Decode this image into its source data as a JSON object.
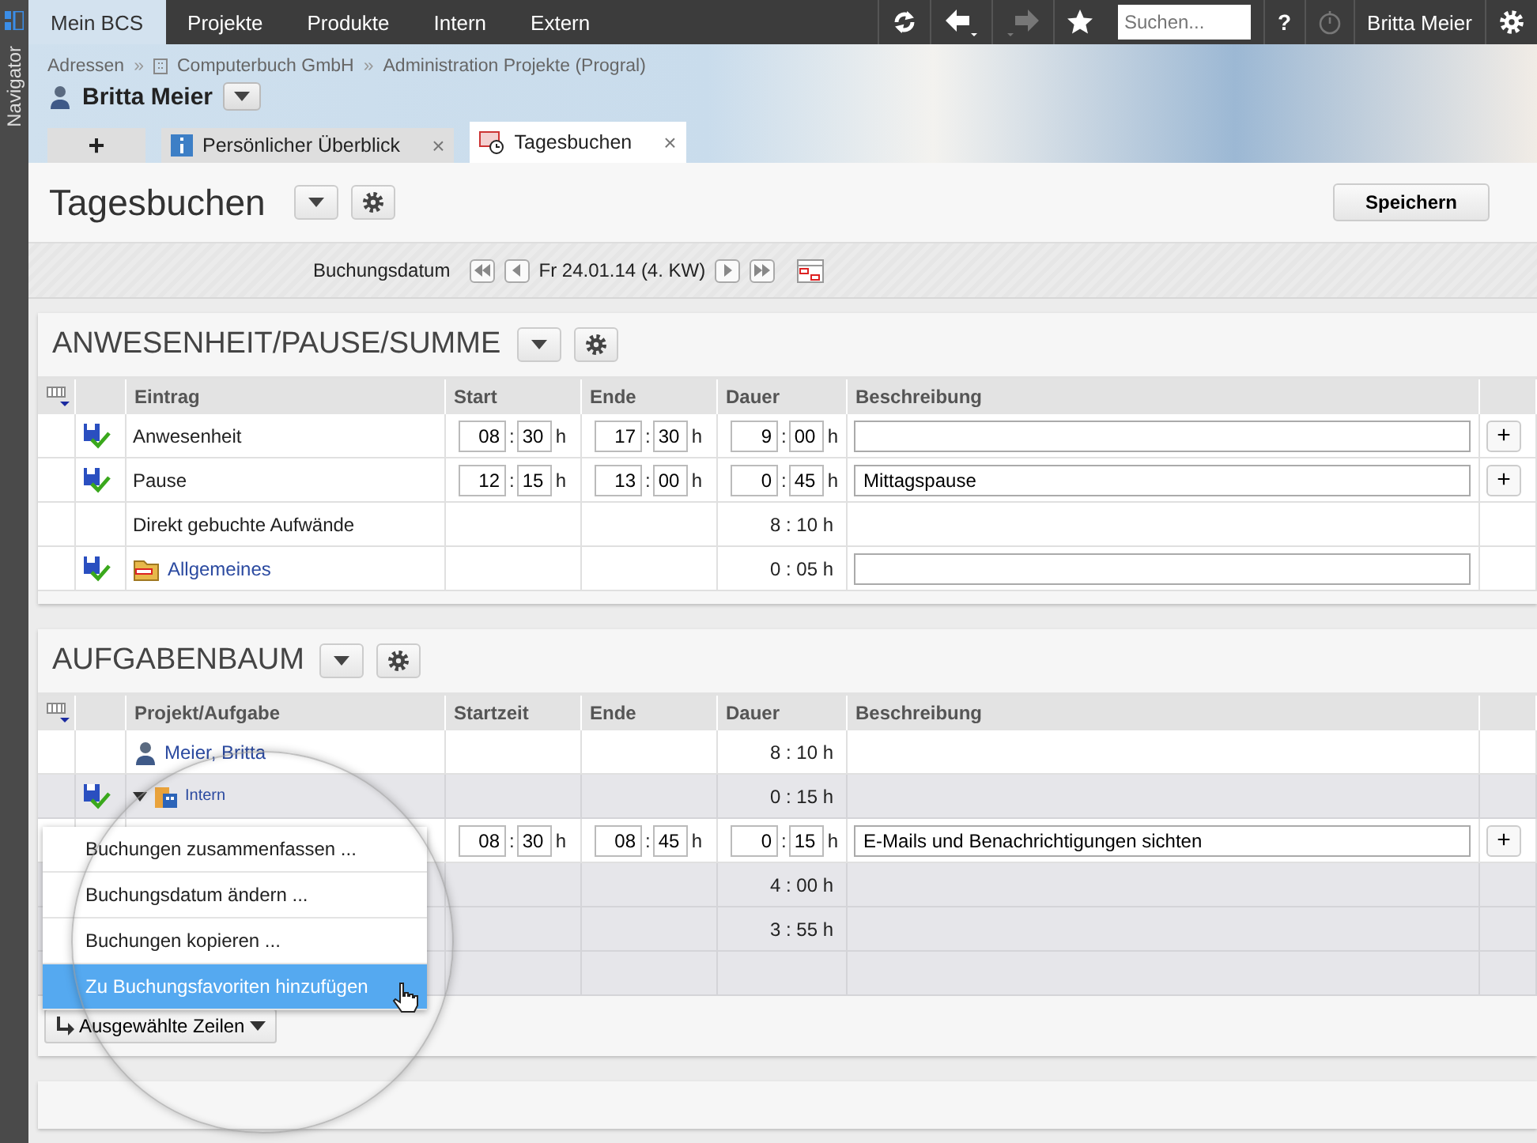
{
  "navigator": {
    "label": "Navigator"
  },
  "top_menu": [
    {
      "label": "Mein BCS",
      "selected": true
    },
    {
      "label": "Projekte",
      "selected": false
    },
    {
      "label": "Produkte",
      "selected": false
    },
    {
      "label": "Intern",
      "selected": false
    },
    {
      "label": "Extern",
      "selected": false
    }
  ],
  "toolbar": {
    "history": [
      {
        "kind": "back",
        "disabled": false
      },
      {
        "kind": "forward",
        "disabled": true
      }
    ],
    "search": {
      "placeholder": "Suchen..."
    },
    "help": "?",
    "timer": {
      "disabled": true
    },
    "user": "Britta Meier"
  },
  "breadcrumb": [
    {
      "label": "Adressen",
      "kind": "plain"
    },
    {
      "separator": "»",
      "label": "Computerbuch GmbH",
      "kind": "company"
    },
    {
      "separator": "»",
      "label": "Administration Projekte (Progral)",
      "kind": "plain"
    }
  ],
  "person": {
    "name": "Britta Meier"
  },
  "tabs": [
    {
      "kind": "add",
      "label": "+",
      "selected": false
    },
    {
      "kind": "info",
      "label": "Persönlicher Überblick",
      "close": "×",
      "selected": false
    },
    {
      "kind": "timesheet",
      "label": "Tagesbuchen",
      "close": "×",
      "selected": true
    }
  ],
  "page": {
    "title": "Tagesbuchen",
    "save": "Speichern"
  },
  "date_bar": {
    "label": "Buchungsdatum",
    "value": "Fr 24.01.14 (4. KW)"
  },
  "attendance": {
    "title": "ANWESENHEIT/PAUSE/SUMME",
    "columns": [
      "Eintrag",
      "Start",
      "Ende",
      "Dauer",
      "Beschreibung"
    ],
    "rows": [
      {
        "kind": "time",
        "saved": true,
        "label": "Anwesenheit",
        "start": {
          "h": "08",
          "sep": ":",
          "m": "30",
          "unit": "h"
        },
        "end": {
          "h": "17",
          "sep": ":",
          "m": "30",
          "unit": "h"
        },
        "duration": {
          "h": "9",
          "sep": ":",
          "m": "00",
          "unit": "h"
        },
        "add": "+"
      },
      {
        "kind": "time",
        "saved": true,
        "label": "Pause",
        "start": {
          "h": "12",
          "sep": ":",
          "m": "15",
          "unit": "h"
        },
        "end": {
          "h": "13",
          "sep": ":",
          "m": "00",
          "unit": "h"
        },
        "duration": {
          "h": "0",
          "sep": ":",
          "m": "45",
          "unit": "h"
        },
        "description": "Mittagspause",
        "add": "+"
      },
      {
        "kind": "sum",
        "saved": false,
        "label": "Direkt gebuchte Aufwände",
        "duration": "8 : 10 h"
      },
      {
        "kind": "project",
        "saved": true,
        "label": "Allgemeines",
        "duration": "0 : 05 h"
      }
    ]
  },
  "tasks": {
    "title": "AUFGABENBAUM",
    "columns": [
      "Projekt/Aufgabe",
      "Startzeit",
      "Ende",
      "Dauer",
      "Beschreibung"
    ],
    "rows": [
      {
        "kind": "person",
        "saved": false,
        "label": "Meier, Britta",
        "duration": "8 : 10 h"
      },
      {
        "kind": "group",
        "saved": true,
        "expanded": true,
        "label": "Intern",
        "duration": "0 : 15 h"
      },
      {
        "kind": "entry",
        "start": {
          "h": "08",
          "sep": ":",
          "m": "30",
          "unit": "h"
        },
        "end": {
          "h": "08",
          "sep": ":",
          "m": "45",
          "unit": "h"
        },
        "duration": {
          "h": "0",
          "sep": ":",
          "m": "15",
          "unit": "h"
        },
        "description": "E-Mails und Benachrichtigungen sichten",
        "add": "+"
      },
      {
        "kind": "task",
        "duration": "4 : 00 h"
      },
      {
        "kind": "task",
        "duration": "3 : 55 h"
      },
      {
        "kind": "footer"
      }
    ],
    "context_menu": [
      {
        "label": "Buchungen zusammenfassen ...",
        "selected": false
      },
      {
        "label": "Buchungsdatum ändern ...",
        "selected": false
      },
      {
        "label": "Buchungen kopieren ...",
        "selected": false
      },
      {
        "label": "Zu Buchungsfavoriten hinzufügen",
        "selected": true
      }
    ],
    "action": "Ausgewählte Zeilen"
  }
}
